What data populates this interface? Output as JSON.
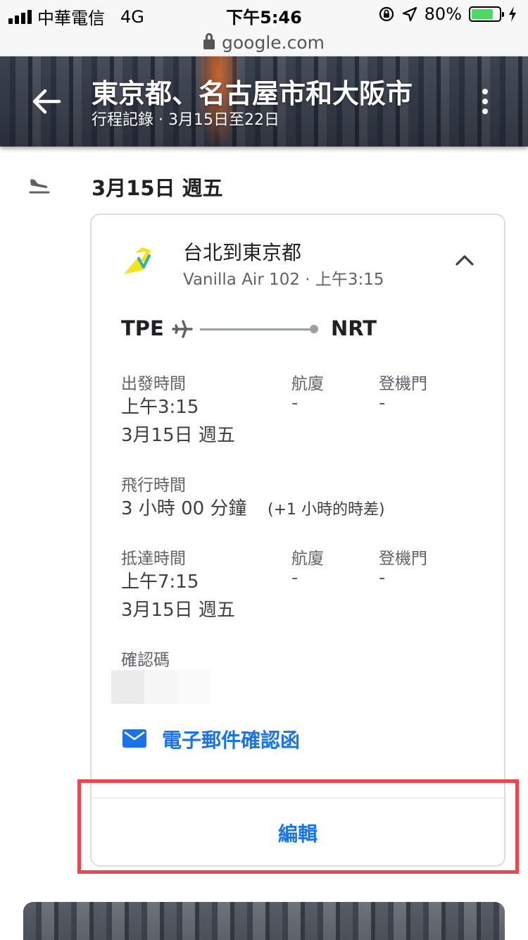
{
  "status_bar": {
    "carrier": "中華電信",
    "network": "4G",
    "time": "下午5:46",
    "battery": "80%"
  },
  "url_bar": {
    "domain": "google.com"
  },
  "header": {
    "title": "東京都、名古屋市和大阪市",
    "subtitle": "行程記錄 · 3月15日至22日"
  },
  "day": {
    "date": "3月15日 週五"
  },
  "flight": {
    "title": "台北到東京都",
    "subtitle": "Vanilla Air 102 · 上午3:15",
    "from": "TPE",
    "to": "NRT",
    "departure": {
      "label": "出發時間",
      "time": "上午3:15",
      "date": "3月15日 週五",
      "terminal_label": "航廈",
      "terminal": "-",
      "gate_label": "登機門",
      "gate": "-"
    },
    "duration": {
      "label": "飛行時間",
      "value": "3 小時 00 分鐘",
      "note": "(+1 小時的時差)"
    },
    "arrival": {
      "label": "抵達時間",
      "time": "上午7:15",
      "date": "3月15日 週五",
      "terminal_label": "航廈",
      "terminal": "-",
      "gate_label": "登機門",
      "gate": "-"
    },
    "confirmation_label": "確認碼",
    "email_link": "電子郵件確認函",
    "edit_label": "編輯"
  },
  "colors": {
    "link": "#1a73e8",
    "highlight": "#e8474e",
    "airline_logo": "#f5e21a"
  }
}
